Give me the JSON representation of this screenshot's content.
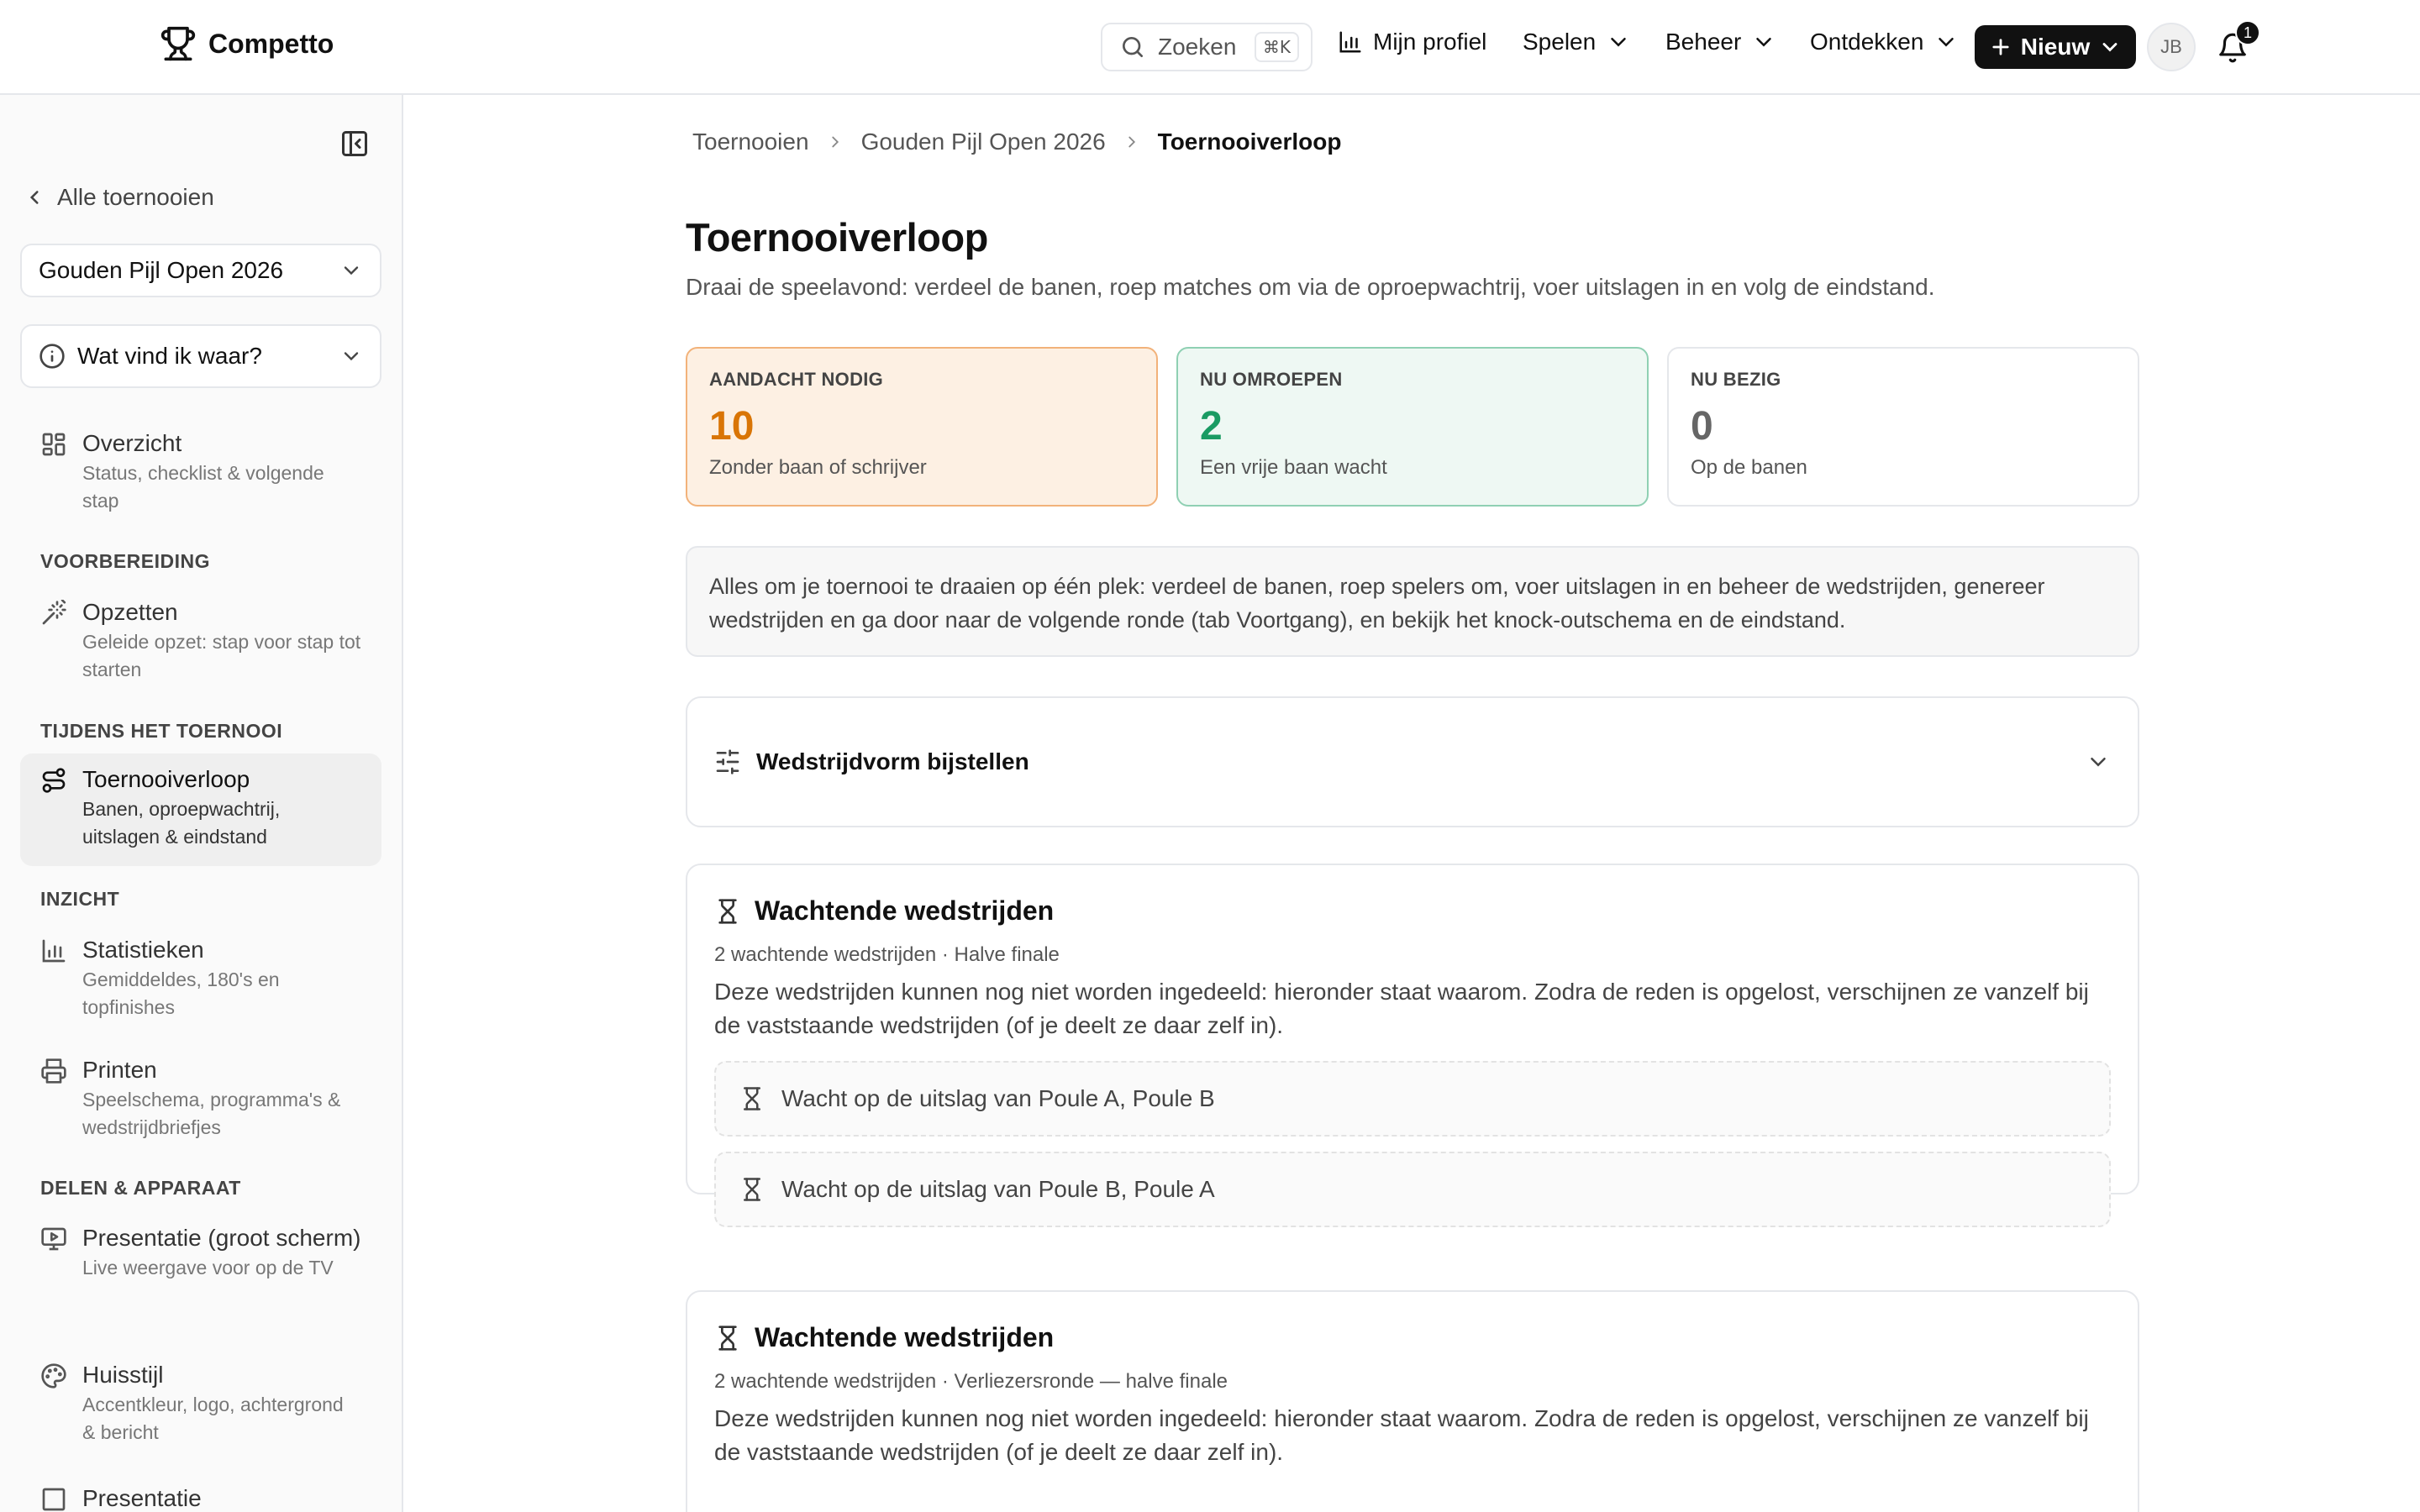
{
  "brand": {
    "name": "Competto"
  },
  "topnav": {
    "search_label": "Zoeken",
    "search_shortcut": "⌘K",
    "profile": "Mijn profiel",
    "play": "Spelen",
    "manage": "Beheer",
    "discover": "Ontdekken",
    "new_button": "Nieuw",
    "avatar_initials": "JB",
    "notification_count": "1"
  },
  "sidebar": {
    "back_link": "Alle toernooien",
    "tournament_select": "Gouden Pijl Open 2026",
    "help_select": "Wat vind ik waar?",
    "overview": {
      "title": "Overzicht",
      "desc": "Status, checklist & volgende stap"
    },
    "sections": {
      "prep": "VOORBEREIDING",
      "during": "TIJDENS HET TOERNOOI",
      "insight": "INZICHT",
      "share": "DELEN & APPARAAT"
    },
    "items": [
      {
        "title": "Opzetten",
        "desc": "Geleide opzet: stap voor stap tot starten"
      },
      {
        "title": "Toernooiverloop",
        "desc": "Banen, oproepwachtrij, uitslagen & eindstand"
      },
      {
        "title": "Statistieken",
        "desc": "Gemiddeldes, 180's en topfinishes"
      },
      {
        "title": "Printen",
        "desc": "Speelschema, programma's & wedstrijdbriefjes"
      },
      {
        "title": "Presentatie (groot scherm)",
        "desc": "Live weergave voor op de TV"
      },
      {
        "title": "Huisstijl",
        "desc": "Accentkleur, logo, achtergrond & bericht"
      },
      {
        "title": "Presentatie",
        "desc": ""
      }
    ]
  },
  "breadcrumb": [
    "Toernooien",
    "Gouden Pijl Open 2026",
    "Toernooiverloop"
  ],
  "page": {
    "title": "Toernooiverloop",
    "subtitle": "Draai de speelavond: verdeel de banen, roep matches om via de oproepwachtrij, voer uitslagen in en volg de eindstand."
  },
  "stats": [
    {
      "label": "AANDACHT NODIG",
      "value": "10",
      "desc": "Zonder baan of schrijver"
    },
    {
      "label": "NU OMROEPEN",
      "value": "2",
      "desc": "Een vrije baan wacht"
    },
    {
      "label": "NU BEZIG",
      "value": "0",
      "desc": "Op de banen"
    }
  ],
  "info_text": "Alles om je toernooi te draaien op één plek: verdeel de banen, roep spelers om, voer uitslagen in en beheer de wedstrijden, genereer wedstrijden en ga door naar de volgende ronde (tab Voortgang), en bekijk het knock-outschema en de eindstand.",
  "format_panel": {
    "title": "Wedstrijdvorm bijstellen"
  },
  "waiting_cards": [
    {
      "title": "Wachtende wedstrijden",
      "meta": "2 wachtende wedstrijden · Halve finale",
      "desc": "Deze wedstrijden kunnen nog niet worden ingedeeld: hieronder staat waarom. Zodra de reden is opgelost, verschijnen ze vanzelf bij de vaststaande wedstrijden (of je deelt ze daar zelf in).",
      "rows": [
        "Wacht op de uitslag van Poule A, Poule B",
        "Wacht op de uitslag van Poule B, Poule A"
      ]
    },
    {
      "title": "Wachtende wedstrijden",
      "meta": "2 wachtende wedstrijden · Verliezersronde — halve finale",
      "desc": "Deze wedstrijden kunnen nog niet worden ingedeeld: hieronder staat waarom. Zodra de reden is opgelost, verschijnen ze vanzelf bij de vaststaande wedstrijden (of je deelt ze daar zelf in).",
      "rows": []
    }
  ]
}
